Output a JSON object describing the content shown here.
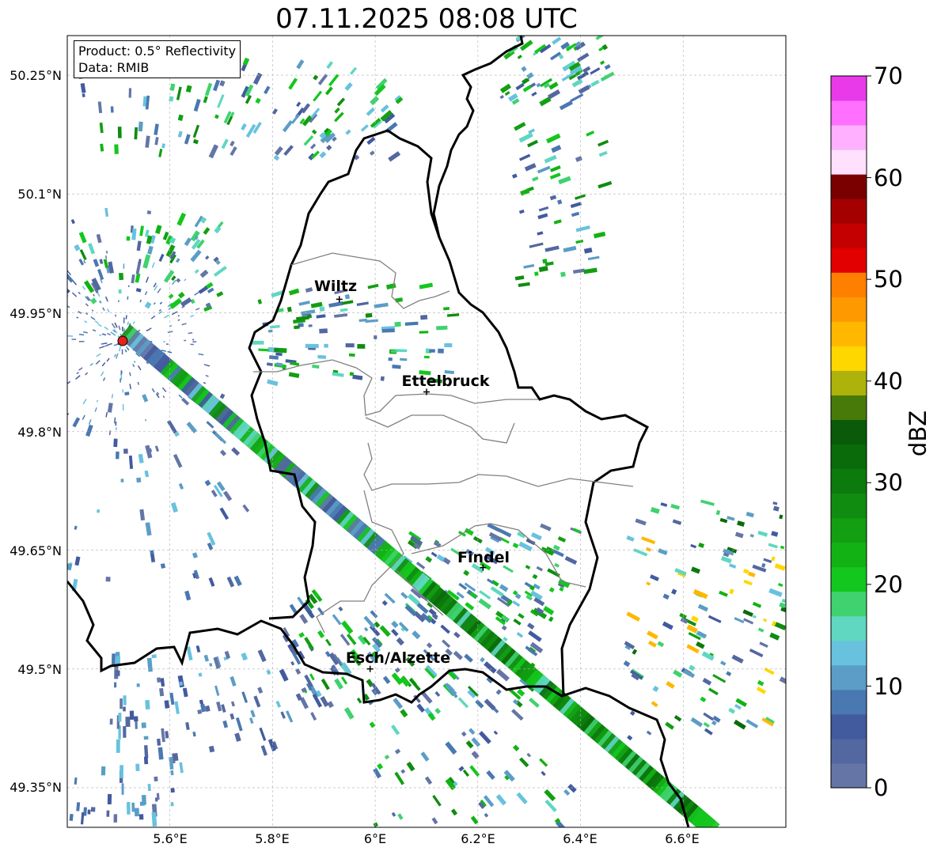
{
  "title": "07.11.2025 08:08 UTC",
  "product_box": {
    "line1": "Product: 0.5° Reflectivity",
    "line2": "Data: RMIB"
  },
  "map": {
    "lon_range": [
      5.4,
      6.8
    ],
    "lat_range": [
      49.3,
      50.3
    ],
    "lat_ticks": [
      "50.25°N",
      "50.1°N",
      "49.95°N",
      "49.8°N",
      "49.65°N",
      "49.5°N",
      "49.35°N"
    ],
    "lon_ticks": [
      "5.6°E",
      "5.8°E",
      "6°E",
      "6.2°E",
      "6.4°E",
      "6.6°E"
    ],
    "gridlines": true,
    "radar_site_color": "#e8201a",
    "cities": [
      {
        "name": "Wiltz",
        "lon": 5.93,
        "lat": 49.967
      },
      {
        "name": "Ettelbruck",
        "lon": 6.1,
        "lat": 49.85
      },
      {
        "name": "Findel",
        "lon": 6.21,
        "lat": 49.628
      },
      {
        "name": "Esch/Alzette",
        "lon": 5.99,
        "lat": 49.5
      }
    ]
  },
  "colorbar": {
    "label": "dBZ",
    "ticks": [
      "70",
      "60",
      "50",
      "40",
      "30",
      "20",
      "10",
      "0"
    ],
    "colors": [
      "#6475a6",
      "#5367a0",
      "#425a9e",
      "#4a78b0",
      "#5b9dc6",
      "#68c2de",
      "#5fd7c1",
      "#3fd26f",
      "#14c71e",
      "#13b214",
      "#129f12",
      "#108c10",
      "#0c7a0c",
      "#0a6b0a",
      "#0a5a0a",
      "#487a0a",
      "#adb30a",
      "#ffd700",
      "#ffb700",
      "#ff9900",
      "#ff7f00",
      "#e20000",
      "#c40000",
      "#a50000",
      "#7a0000",
      "#ffe0ff",
      "#ffb0ff",
      "#ff70ff",
      "#e83ae8"
    ]
  }
}
